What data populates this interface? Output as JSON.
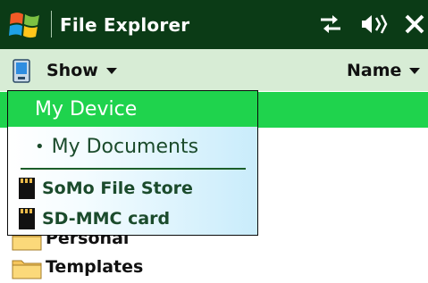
{
  "titlebar": {
    "app_title": "File Explorer",
    "icons": [
      "windows-logo",
      "connectivity-icon",
      "volume-icon",
      "close-icon"
    ]
  },
  "commandbar": {
    "show_label": "Show",
    "sort_label": "Name",
    "icons": [
      "device-icon",
      "chevron-down-icon"
    ]
  },
  "dropdown": {
    "items": [
      {
        "label": "My Device",
        "selected": true
      },
      {
        "label": "My Documents",
        "bullet": "•"
      },
      {
        "label": "SoMo File Store",
        "icon": "storage-card-icon"
      },
      {
        "label": "SD-MMC card",
        "icon": "storage-card-icon"
      }
    ]
  },
  "file_list": {
    "items": [
      {
        "label": "Personal",
        "icon": "folder-icon"
      },
      {
        "label": "Templates",
        "icon": "folder-icon"
      }
    ]
  },
  "colors": {
    "titlebar_bg": "#0b3b16",
    "commandbar_bg": "#d7ecd5",
    "selection_green": "#1fd34d",
    "menu_text": "#1b4b2c"
  }
}
